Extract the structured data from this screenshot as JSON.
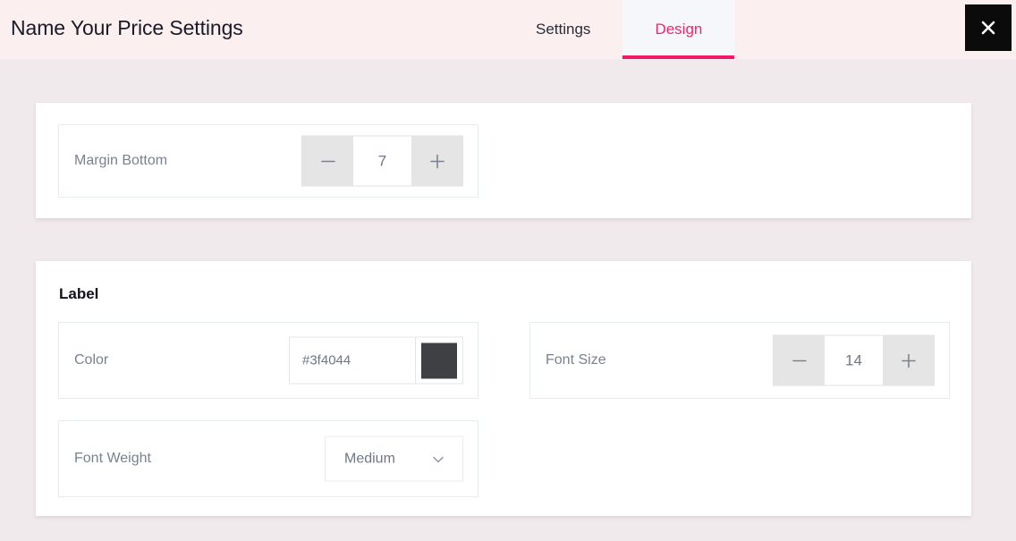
{
  "header": {
    "title": "Name Your Price Settings",
    "tabs": [
      {
        "label": "Settings",
        "active": false
      },
      {
        "label": "Design",
        "active": true
      }
    ],
    "close_label": "×",
    "close_icon": "close-icon",
    "accent_color": "#f4186b",
    "background": "#fbf0ef"
  },
  "cards": {
    "margin": {
      "row": {
        "label": "Margin Bottom",
        "control": "stepper",
        "value": "7",
        "minus_icon": "minus-icon",
        "plus_icon": "plus-icon"
      }
    },
    "label_section": {
      "title": "Label",
      "color_row": {
        "label": "Color",
        "control": "color",
        "value": "#3f4044",
        "placeholder": "#3f4044",
        "swatch_color": "#3f4044"
      },
      "font_size_row": {
        "label": "Font Size",
        "control": "stepper",
        "value": "14",
        "minus_icon": "minus-icon",
        "plus_icon": "plus-icon"
      },
      "font_weight_row": {
        "label": "Font Weight",
        "control": "select",
        "value": "Medium",
        "chevron_icon": "chevron-down-icon"
      }
    }
  }
}
